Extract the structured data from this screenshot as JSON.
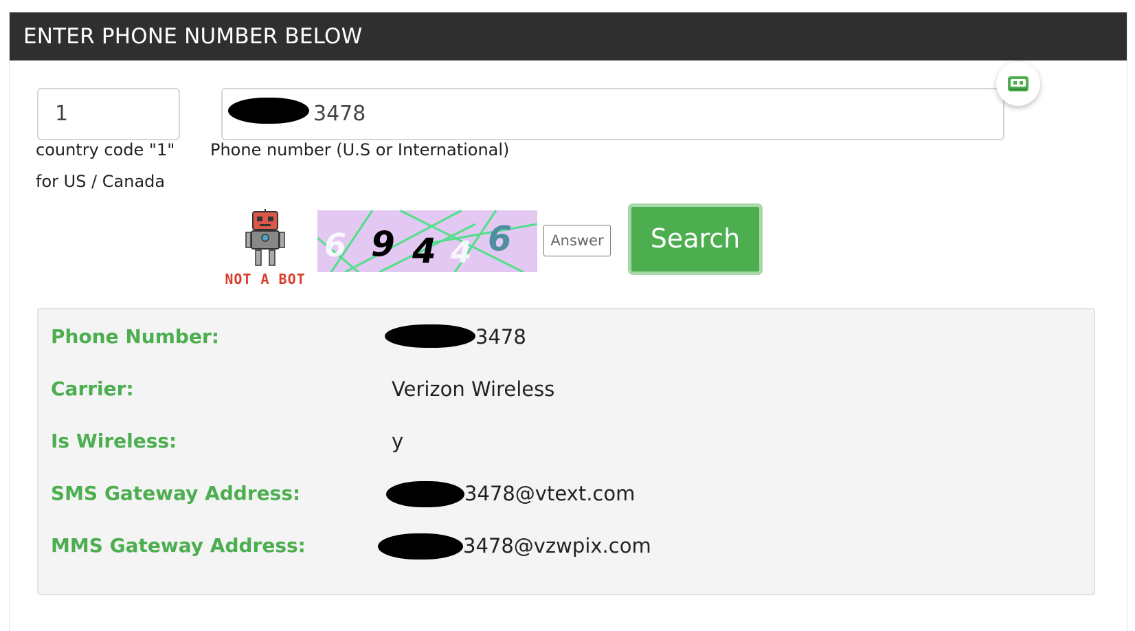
{
  "header": {
    "title": "ENTER PHONE NUMBER BELOW"
  },
  "form": {
    "country_code_value": "1",
    "country_code_help_line1": "country code \"1\"",
    "country_code_help_line2": "for US / Canada",
    "phone_value_visible": "3478",
    "phone_help": "Phone number (U.S or International)"
  },
  "captcha": {
    "badge_text": "NOT A BOT",
    "digits": [
      "6",
      "9",
      "4",
      "4",
      "6"
    ],
    "answer_placeholder": "Answer"
  },
  "search_button": {
    "label": "Search"
  },
  "results": [
    {
      "label": "Phone Number:",
      "value": "3478",
      "redacted": true
    },
    {
      "label": "Carrier:",
      "value": "Verizon Wireless",
      "redacted": false
    },
    {
      "label": "Is Wireless:",
      "value": "y",
      "redacted": false
    },
    {
      "label": "SMS Gateway Address:",
      "value": "3478@vtext.com",
      "redacted": true
    },
    {
      "label": "MMS Gateway Address:",
      "value": "3478@vzwpix.com",
      "redacted": true
    }
  ],
  "colors": {
    "header_bg": "#2f2f2f",
    "accent_green": "#4cae4f",
    "captcha_bg": "#e3c8f2",
    "robot_red": "#d93c2b"
  },
  "icons": {
    "extension": "roboform-icon",
    "captcha_badge": "robot-icon"
  }
}
